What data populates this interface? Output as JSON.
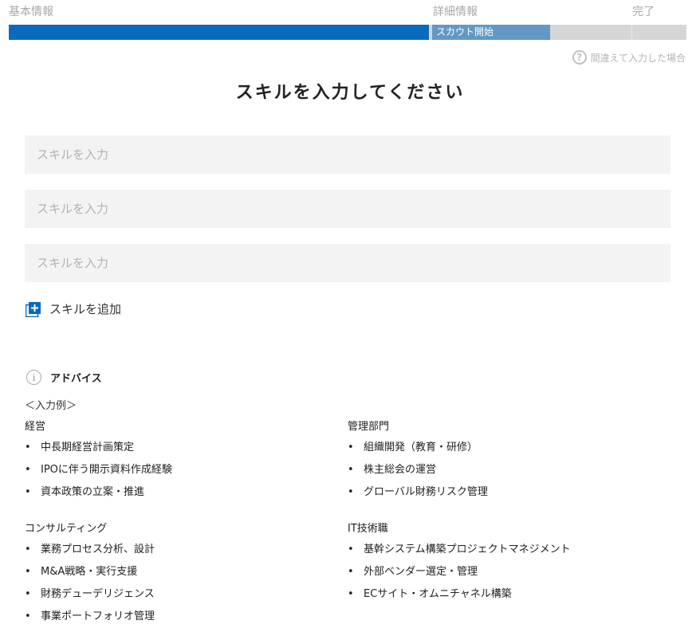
{
  "progress": {
    "steps": [
      "基本情報",
      "詳細情報",
      "完了"
    ],
    "current_label": "スカウト開始",
    "percent_complete": 62,
    "colors": {
      "filled": "#0a6abe",
      "current": "#6398c4",
      "remaining": "#d6d6d6"
    }
  },
  "help": {
    "icon": "question-circle-icon",
    "label": "間違えて入力した場合"
  },
  "title": "スキルを入力してください",
  "inputs": [
    {
      "placeholder": "スキルを入力",
      "value": ""
    },
    {
      "placeholder": "スキルを入力",
      "value": ""
    },
    {
      "placeholder": "スキルを入力",
      "value": ""
    }
  ],
  "add_skill": {
    "icon": "add-box-icon",
    "label": "スキルを追加",
    "color": "#0a6abe"
  },
  "advice": {
    "icon": "info-icon",
    "title": "アドバイス",
    "example_label": "＜入力例＞",
    "groups": [
      {
        "title": "経営",
        "items": [
          "中長期経営計画策定",
          "IPOに伴う開示資料作成経験",
          "資本政策の立案・推進"
        ]
      },
      {
        "title": "管理部門",
        "items": [
          "組織開発（教育・研修）",
          "株主総会の運営",
          "グローバル財務リスク管理"
        ]
      },
      {
        "title": "コンサルティング",
        "items": [
          "業務プロセス分析、設計",
          "M&A戦略・実行支援",
          "財務デューデリジェンス",
          "事業ポートフォリオ管理"
        ]
      },
      {
        "title": "IT技術職",
        "items": [
          "基幹システム構築プロジェクトマネジメント",
          "外部ベンダー選定・管理",
          "ECサイト・オムニチャネル構築"
        ]
      }
    ]
  }
}
